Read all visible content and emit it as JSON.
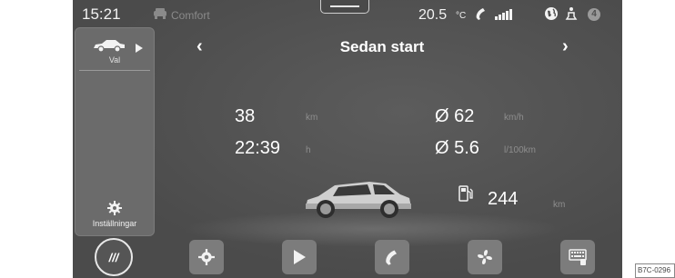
{
  "status": {
    "time": "15:21",
    "profile_label": "Comfort",
    "temperature": "20.5",
    "temperature_unit": "°C",
    "notification_count": "4"
  },
  "side_panel": {
    "selection_label": "Val",
    "settings_label": "Inställningar"
  },
  "trip": {
    "title": "Sedan start",
    "distance": "38",
    "distance_unit": "km",
    "duration": "22:39",
    "duration_unit": "h",
    "avg_speed": "Ø 62",
    "avg_speed_unit": "km/h",
    "avg_consumption": "Ø 5.6",
    "avg_consumption_unit": "l/100km",
    "range": "244",
    "range_unit": "km"
  },
  "dock": {
    "menu_label": "///"
  },
  "reference_code": "B7C-0296"
}
